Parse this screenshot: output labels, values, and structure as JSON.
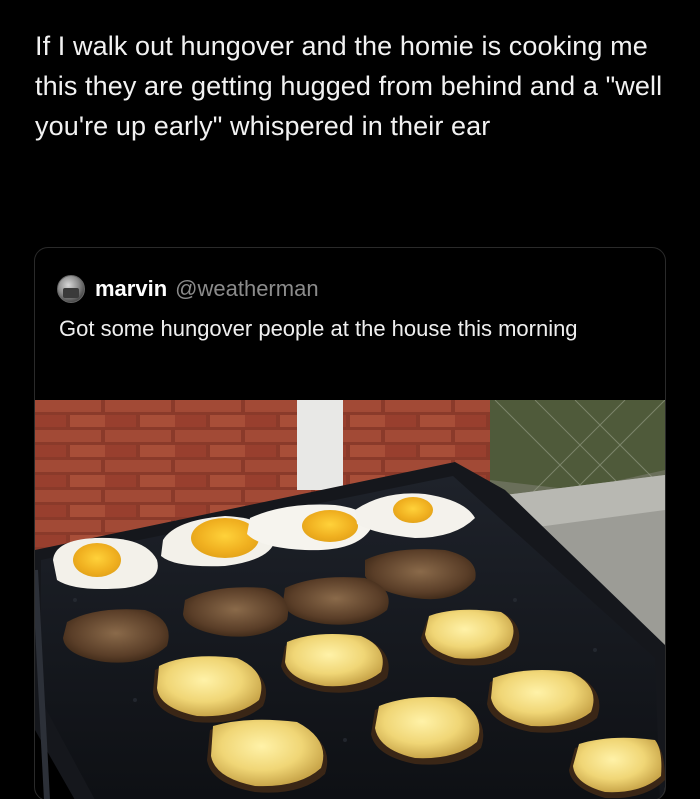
{
  "post": {
    "text": "If I walk out hungover and the homie is cooking me this they are getting hugged from behind and a \"well you're up early\" whispered in their ear"
  },
  "quoted_tweet": {
    "display_name": "marvin",
    "handle": "@weatherman",
    "text": "Got some hungover people at the house this morning"
  },
  "colors": {
    "background": "#000000",
    "text": "#f2f2f2",
    "handle": "#8b8b8b",
    "card_border": "#2a2a2a"
  },
  "icons": {
    "avatar": "user-avatar"
  }
}
